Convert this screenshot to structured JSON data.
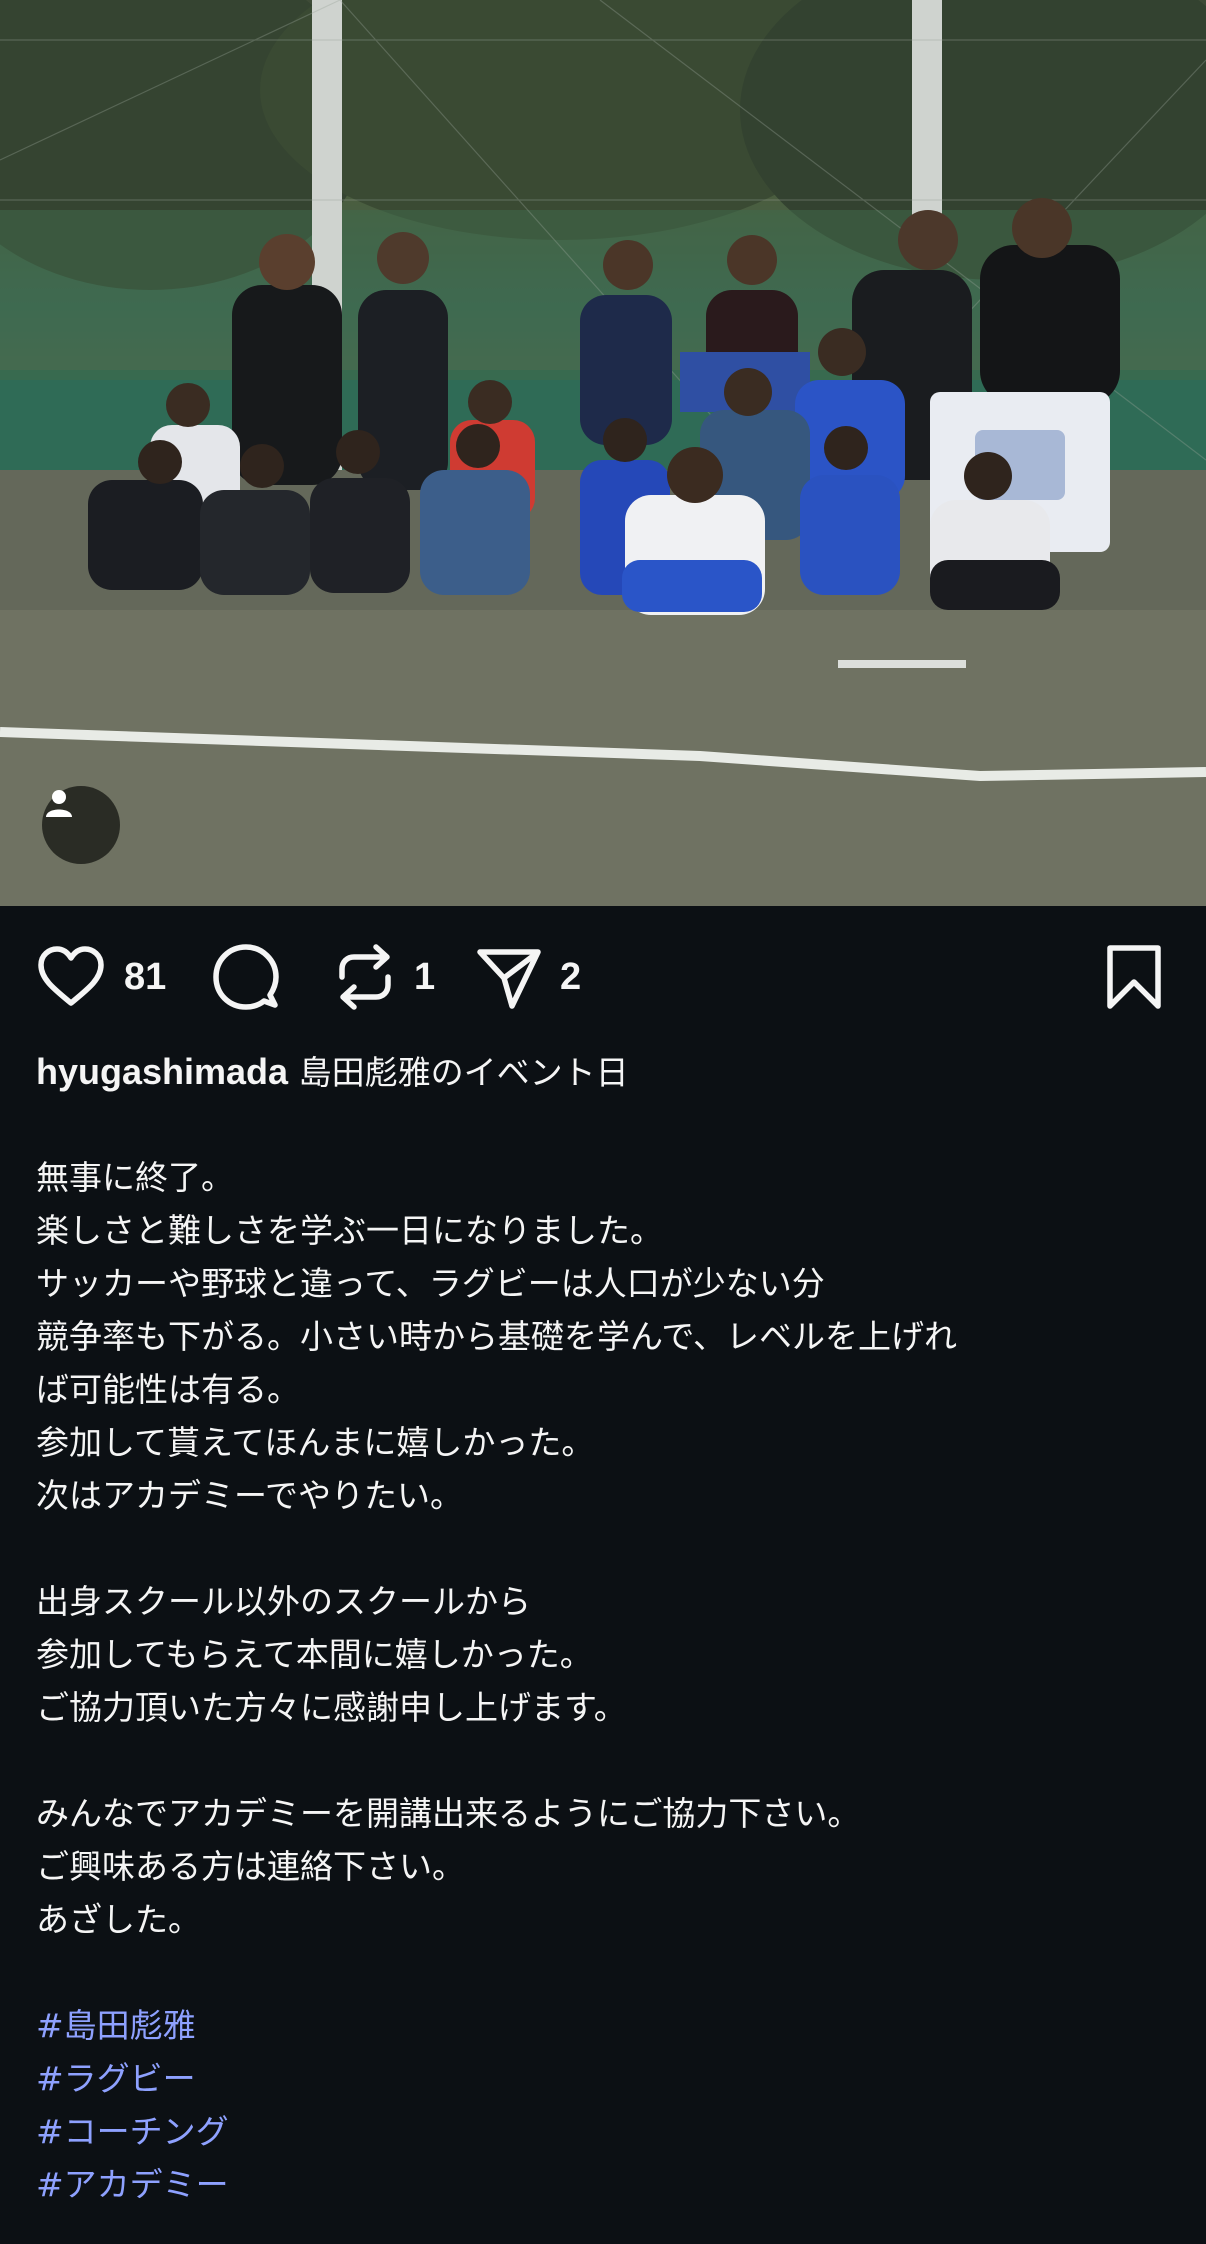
{
  "post": {
    "photo_alt": "group photo"
  },
  "actions": {
    "likes": "81",
    "reposts": "1",
    "shares": "2"
  },
  "caption": {
    "username": "hyugashimada",
    "title": "島田彪雅のイベント日",
    "lines": [
      "",
      "無事に終了。",
      "楽しさと難しさを学ぶ一日になりました。",
      "サッカーや野球と違って、ラグビーは人口が少ない分",
      "競争率も下がる。小さい時から基礎を学んで、レベルを上げれ",
      "ば可能性は有る。",
      "参加して貰えてほんまに嬉しかった。",
      "次はアカデミーでやりたい。",
      "",
      "出身スクール以外のスクールから",
      "参加してもらえて本間に嬉しかった。",
      "ご協力頂いた方々に感謝申し上げます。",
      "",
      "みんなでアカデミーを開講出来るようにご協力下さい。",
      "ご興味ある方は連絡下さい。",
      "あざした。",
      ""
    ],
    "hashtags": [
      "#島田彪雅",
      "#ラグビー",
      "#コーチング",
      "#アカデミー"
    ]
  },
  "colors": {
    "background": "#0c1014",
    "text": "#f5f5f5",
    "hashtag": "#8ea1ff"
  },
  "icons": [
    "heart-icon",
    "comment-icon",
    "repost-icon",
    "share-icon",
    "bookmark-icon",
    "user-tag-icon"
  ]
}
